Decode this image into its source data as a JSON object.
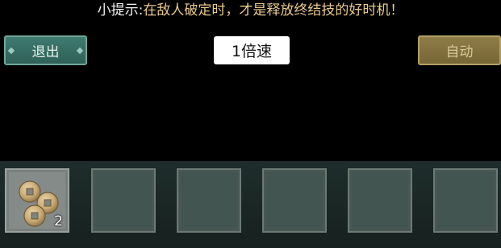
{
  "tip": {
    "prefix": "小提示:",
    "body": "在敌人破定时，才是释放终结技的好时机！"
  },
  "buttons": {
    "exit_label": "退出",
    "speed_label": "1倍速",
    "auto_label": "自动"
  },
  "skillbar": {
    "slots": [
      {
        "item": "coins-icon",
        "count": "2"
      },
      {
        "item": "",
        "count": ""
      },
      {
        "item": "",
        "count": ""
      },
      {
        "item": "",
        "count": ""
      },
      {
        "item": "",
        "count": ""
      },
      {
        "item": "",
        "count": ""
      }
    ]
  },
  "colors": {
    "exit_button": "#3f7a70",
    "auto_button": "#8f7d48",
    "tip_highlight": "#e8c98a"
  }
}
